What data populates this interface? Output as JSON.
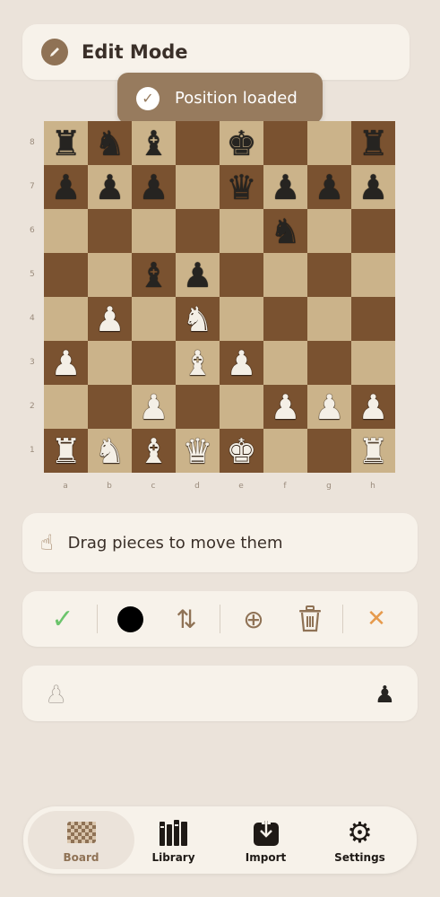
{
  "header": {
    "title": "Edit Mode",
    "icon": "pencil-icon"
  },
  "toast": {
    "text": "Position loaded",
    "icon": "checkmark-circle-icon"
  },
  "board": {
    "ranks": [
      "8",
      "7",
      "6",
      "5",
      "4",
      "3",
      "2",
      "1"
    ],
    "files": [
      "a",
      "b",
      "c",
      "d",
      "e",
      "f",
      "g",
      "h"
    ],
    "position": [
      [
        "r",
        "n",
        "b",
        "",
        "k",
        "",
        "",
        "r"
      ],
      [
        "p",
        "p",
        "p",
        "",
        "q",
        "p",
        "p",
        "p"
      ],
      [
        "",
        "",
        "",
        "",
        "",
        "n",
        "",
        ""
      ],
      [
        "",
        "",
        "b",
        "p",
        "",
        "",
        "",
        ""
      ],
      [
        "",
        "P",
        "",
        "N",
        "",
        "",
        "",
        ""
      ],
      [
        "P",
        "",
        "",
        "B",
        "P",
        "",
        "",
        ""
      ],
      [
        "",
        "",
        "P",
        "",
        "",
        "P",
        "P",
        "P"
      ],
      [
        "R",
        "N",
        "B",
        "Q",
        "K",
        "",
        "",
        "R"
      ]
    ],
    "colors": {
      "light": "#cbb38a",
      "dark": "#7a5230"
    }
  },
  "hint": {
    "text": "Drag pieces to move them",
    "icon": "hand-drag-icon"
  },
  "toolbar": {
    "items": [
      {
        "name": "confirm-button",
        "icon": "checkmark-icon",
        "glyph": "✓",
        "color": "#6cc46c"
      },
      {
        "name": "side-to-move-button",
        "icon": "black-circle-icon",
        "glyph": "●",
        "color": "#000000"
      },
      {
        "name": "flip-board-button",
        "icon": "swap-arrows-icon",
        "glyph": "⇅",
        "color": "#8f7255"
      },
      {
        "name": "add-piece-button",
        "icon": "plus-circle-icon",
        "glyph": "⊕",
        "color": "#8f7255"
      },
      {
        "name": "clear-board-button",
        "icon": "trash-icon",
        "glyph": "🗑",
        "color": "#8f7255"
      },
      {
        "name": "cancel-button",
        "icon": "close-icon",
        "glyph": "✕",
        "color": "#e69a4c"
      }
    ]
  },
  "reserve": {
    "white_icon": "white-pawn-icon",
    "black_icon": "black-pawn-icon"
  },
  "tabbar": {
    "tabs": [
      {
        "label": "Board",
        "icon": "chessboard-icon",
        "active": true
      },
      {
        "label": "Library",
        "icon": "books-icon",
        "active": false
      },
      {
        "label": "Import",
        "icon": "download-icon",
        "active": false
      },
      {
        "label": "Settings",
        "icon": "gear-icon",
        "active": false
      }
    ],
    "active_color": "#8f7255"
  }
}
